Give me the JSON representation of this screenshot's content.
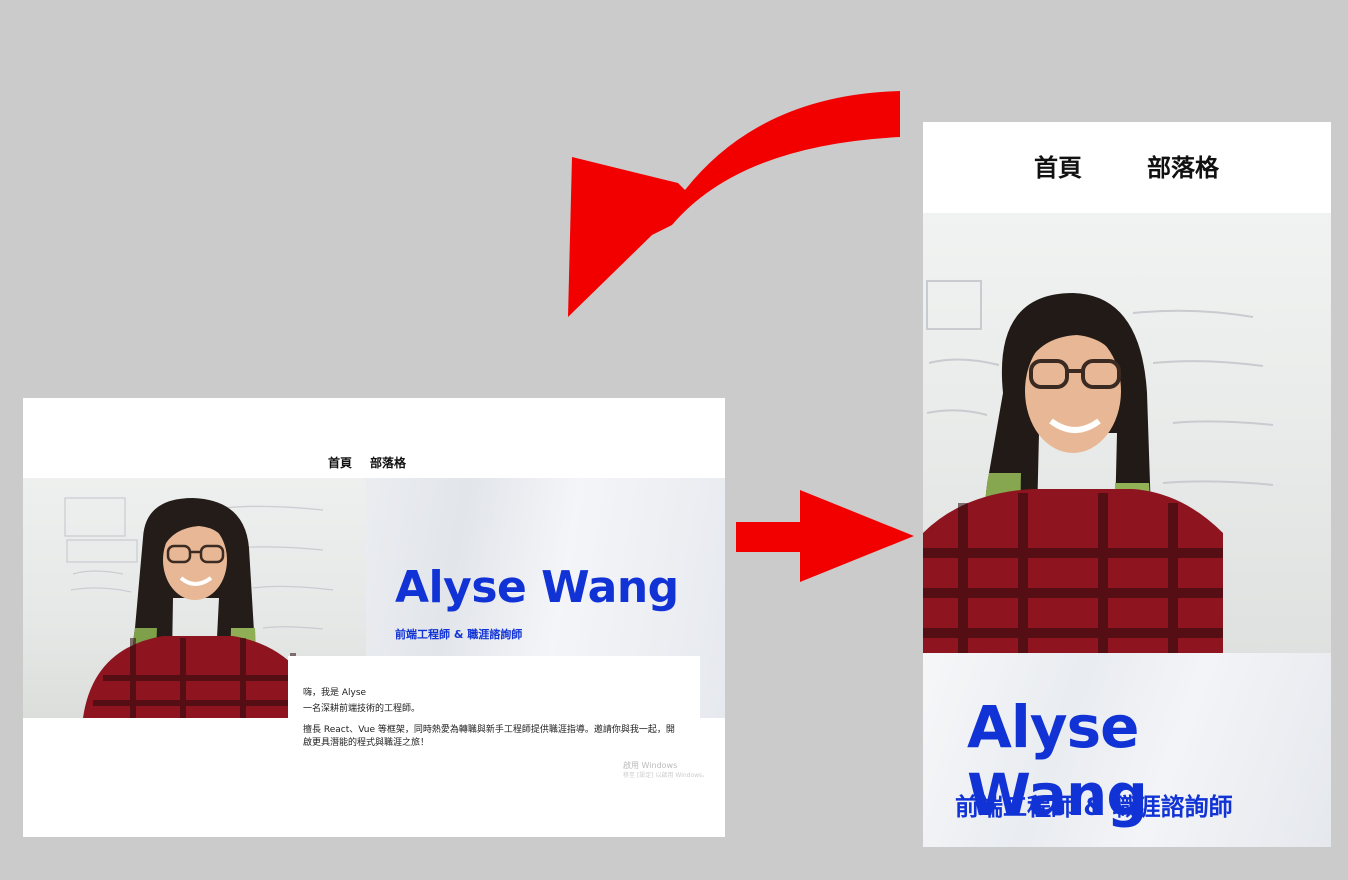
{
  "desktop": {
    "nav": {
      "home": "首頁",
      "blog": "部落格"
    },
    "hero": {
      "name": "Alyse Wang",
      "role": "前端工程師 & 職涯諮詢師"
    },
    "intro": {
      "line1": "嗨，我是 Alyse",
      "line2": "一名深耕前端技術的工程師。",
      "line3": "擅長 React、Vue 等框架，同時熱愛為轉職與新手工程師提供職涯指導。邀請你與我一起，開",
      "line4": "啟更具潛能的程式與職涯之旅！"
    },
    "watermark": {
      "line1": "啟用 Windows",
      "line2": "移至 [設定] 以啟用 Windows。"
    }
  },
  "mobile": {
    "nav": {
      "home": "首頁",
      "blog": "部落格"
    },
    "hero": {
      "name": "Alyse Wang",
      "role": "前端工程師 & 職涯諮詢師"
    }
  },
  "colors": {
    "background": "#cbcbcb",
    "accent": "#1133d6",
    "arrow": "#f20000"
  }
}
